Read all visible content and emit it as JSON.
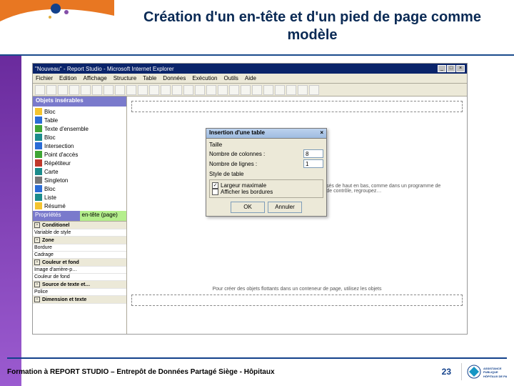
{
  "slide": {
    "title": "Création d'un en-tête et d'un pied de page comme modèle",
    "footer_text": "Formation à REPORT STUDIO – Entrepôt de Données Partagé Siège - Hôpitaux",
    "page_number": "23",
    "logo_text": "ASSISTANCE PUBLIQUE – HÔPITAUX DE PARIS"
  },
  "ie": {
    "title": "\"Nouveau\" - Report Studio - Microsoft Internet Explorer",
    "min": "_",
    "max": "□",
    "close": "×"
  },
  "menu": {
    "items": [
      "Fichier",
      "Edition",
      "Affichage",
      "Structure",
      "Table",
      "Données",
      "Exécution",
      "Outils",
      "Aide"
    ]
  },
  "panels": {
    "insertable_title": "Objets insérables",
    "properties_title": "Propriétés",
    "properties_tab": "en-tête (page)"
  },
  "insertable": [
    {
      "icon": "ic-yellow",
      "label": "Bloc"
    },
    {
      "icon": "ic-blue",
      "label": "Table"
    },
    {
      "icon": "ic-green",
      "label": "Texte d'ensemble"
    },
    {
      "icon": "ic-teal",
      "label": "Bloc"
    },
    {
      "icon": "ic-blue",
      "label": "Intersection"
    },
    {
      "icon": "ic-green",
      "label": "Point d'accès"
    },
    {
      "icon": "ic-red",
      "label": "Répétiteur"
    },
    {
      "icon": "ic-teal",
      "label": "Carte"
    },
    {
      "icon": "ic-gray",
      "label": "Singleton"
    },
    {
      "icon": "ic-blue",
      "label": "Bloc"
    },
    {
      "icon": "ic-teal",
      "label": "Liste"
    },
    {
      "icon": "ic-yellow",
      "label": "Résumé"
    }
  ],
  "properties": [
    {
      "type": "group",
      "label": "Conditionel"
    },
    {
      "type": "row",
      "label": "Variable de style"
    },
    {
      "type": "group",
      "label": "Zone"
    },
    {
      "type": "row",
      "label": "Bordure"
    },
    {
      "type": "row",
      "label": "Cadrage"
    },
    {
      "type": "group",
      "label": "Couleur et fond"
    },
    {
      "type": "row",
      "label": "Image d'arrière-p…"
    },
    {
      "type": "row",
      "label": "Couleur de fond"
    },
    {
      "type": "group",
      "label": "Source de texte et…"
    },
    {
      "type": "row",
      "label": "Police"
    },
    {
      "type": "group",
      "label": "Dimension et texte"
    }
  ],
  "canvas": {
    "breadcrumb": "",
    "tip1": "Déposez les objets sont disposés de haut en bas, comme dans un programme de traitement de texte. Pour plus de contrôle, regroupez…",
    "tip2": "Pour créer des objets flottants dans un conteneur de page, utilisez les objets"
  },
  "dialog": {
    "title": "Insertion d'une table",
    "close": "×",
    "size_label": "Taille",
    "cols_label": "Nombre de colonnes :",
    "cols_value": "8",
    "rows_label": "Nombre de lignes :",
    "rows_value": "1",
    "style_label": "Style de table",
    "chk1": "Largeur maximale",
    "chk2": "Afficher les bordures",
    "ok": "OK",
    "cancel": "Annuler"
  }
}
